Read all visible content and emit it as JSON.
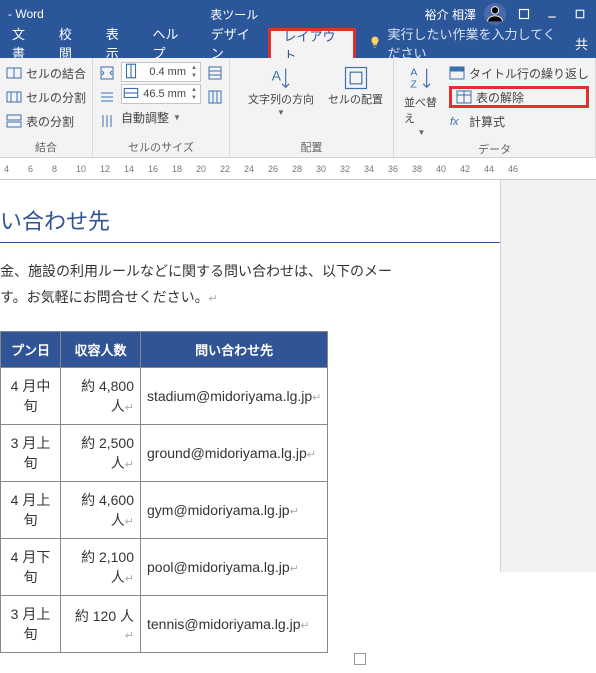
{
  "titlebar": {
    "app": "- Word",
    "context": "表ツール",
    "user": "裕介 相澤"
  },
  "tabs": {
    "items": [
      "文書",
      "校閲",
      "表示",
      "ヘルプ",
      "デザイン",
      "レイアウト"
    ],
    "tell_me": "実行したい作業を入力してください",
    "share": "共"
  },
  "ribbon": {
    "merge": {
      "cell_merge": "セルの結合",
      "cell_split": "セルの分割",
      "table_split": "表の分割",
      "label": "結合"
    },
    "size": {
      "height": "0.4 mm",
      "width": "46.5 mm",
      "autofit": "自動調整",
      "label": "セルのサイズ"
    },
    "align": {
      "text_dir": "文字列の方向",
      "cell_margin": "セルの配置",
      "label": "配置"
    },
    "data": {
      "sort": "並べ替え",
      "repeat_header": "タイトル行の繰り返し",
      "convert": "表の解除",
      "formula": "計算式",
      "label": "データ"
    }
  },
  "ruler": [
    "4",
    "6",
    "8",
    "10",
    "12",
    "14",
    "16",
    "18",
    "20",
    "22",
    "24",
    "26",
    "28",
    "30",
    "32",
    "34",
    "36",
    "38",
    "40",
    "42",
    "44",
    "46"
  ],
  "doc": {
    "heading": "い合わせ先",
    "paragraph": "金、施設の利用ルールなどに関する問い合わせは、以下のメールアドレスまでご連絡をお願いします。お気軽にお問合せください。",
    "paragraph_visible1": "金、施設の利用ルールなどに関する問い合わせは、以下のメー",
    "paragraph_visible2": "す。お気軽にお問合せください。",
    "columns": [
      "プン日",
      "収容人数",
      "問い合わせ先"
    ],
    "rows": [
      {
        "date": "4 月中旬",
        "cap": "約 4,800 人",
        "mail": "stadium@midoriyama.lg.jp"
      },
      {
        "date": "3 月上旬",
        "cap": "約 2,500 人",
        "mail": "ground@midoriyama.lg.jp"
      },
      {
        "date": "4 月上旬",
        "cap": "約 4,600 人",
        "mail": "gym@midoriyama.lg.jp"
      },
      {
        "date": "4 月下旬",
        "cap": "約 2,100 人",
        "mail": "pool@midoriyama.lg.jp"
      },
      {
        "date": "3 月上旬",
        "cap": "約 120 人",
        "mail": "tennis@midoriyama.lg.jp"
      }
    ]
  }
}
